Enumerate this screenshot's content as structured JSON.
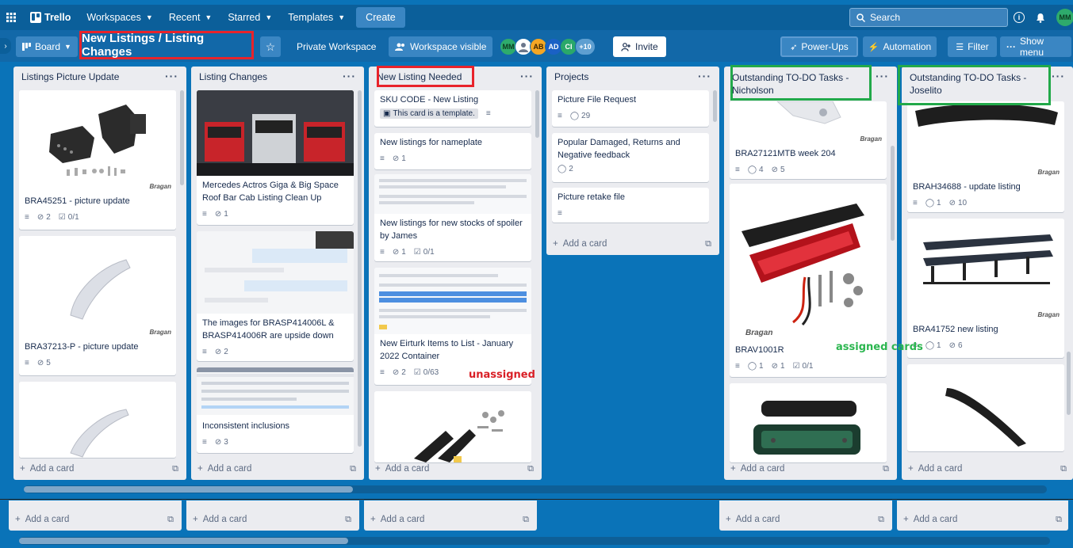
{
  "topbar": {
    "logo": "Trello",
    "nav": [
      {
        "label": "Workspaces"
      },
      {
        "label": "Recent"
      },
      {
        "label": "Starred"
      },
      {
        "label": "Templates"
      }
    ],
    "create": "Create",
    "search_label": "Search",
    "user_initials": "MM"
  },
  "boardbar": {
    "view": "Board",
    "title": "New Listings / Listing Changes",
    "workspace": "Private Workspace",
    "visibility": "Workspace visible",
    "members": [
      "MM",
      "",
      "AB",
      "AD",
      "CI"
    ],
    "more_members": "+10",
    "invite": "Invite",
    "powerups": "Power-Ups",
    "automation": "Automation",
    "filter": "Filter",
    "show_menu": "Show menu"
  },
  "lists": [
    {
      "title": "Listings Picture Update",
      "cards": [
        {
          "title": "BRA45251 - picture update",
          "attachments": "2",
          "checklist": "0/1"
        },
        {
          "title": "BRA37213-P - picture update",
          "attachments": "5"
        }
      ]
    },
    {
      "title": "Listing Changes",
      "cards": [
        {
          "title": "Mercedes Actros Giga & Big Space Roof Bar Cab Listing Clean Up",
          "attachments": "1"
        },
        {
          "title": "The images for BRASP414006L & BRASP414006R are upside down",
          "attachments": "2"
        },
        {
          "title": "Inconsistent inclusions",
          "attachments": "3"
        }
      ]
    },
    {
      "title": "New Listing Needed",
      "cards": [
        {
          "title": "SKU CODE - New Listing",
          "template_badge": "This card is a template."
        },
        {
          "title": "New listings for nameplate",
          "attachments": "1"
        },
        {
          "title": "New listings for new stocks of spoiler by James",
          "attachments": "1",
          "checklist": "0/1"
        },
        {
          "title": "New Eirturk Items to List - January 2022 Container",
          "attachments": "2",
          "checklist": "0/63"
        }
      ]
    },
    {
      "title": "Projects",
      "cards": [
        {
          "title": "Picture File Request",
          "comments": "29"
        },
        {
          "title": "Popular Damaged, Returns and Negative feedback",
          "comments": "2"
        },
        {
          "title": "Picture retake file"
        }
      ]
    },
    {
      "title": "Outstanding TO-DO Tasks - Nicholson",
      "cards": [
        {
          "title": "BRA27121MTB week 204",
          "comments": "4",
          "attachments": "5"
        },
        {
          "title": "BRAV1001R",
          "comments": "1",
          "attachments": "1",
          "checklist": "0/1"
        }
      ]
    },
    {
      "title": "Outstanding TO-DO Tasks - Joselito",
      "cards": [
        {
          "title": "BRAH34688 - update listing",
          "comments": "1",
          "attachments": "10"
        },
        {
          "title": "BRA41752 new listing",
          "comments": "1",
          "attachments": "6"
        }
      ]
    }
  ],
  "add_card": "Add a card",
  "brand_watermark": "Bragan",
  "annotations": {
    "unassigned": "unassigned",
    "assigned": "assigned cards"
  },
  "colors": {
    "board_bg": "#0a73b8",
    "highlight_red": "#e8232b",
    "highlight_green": "#22a94a"
  }
}
